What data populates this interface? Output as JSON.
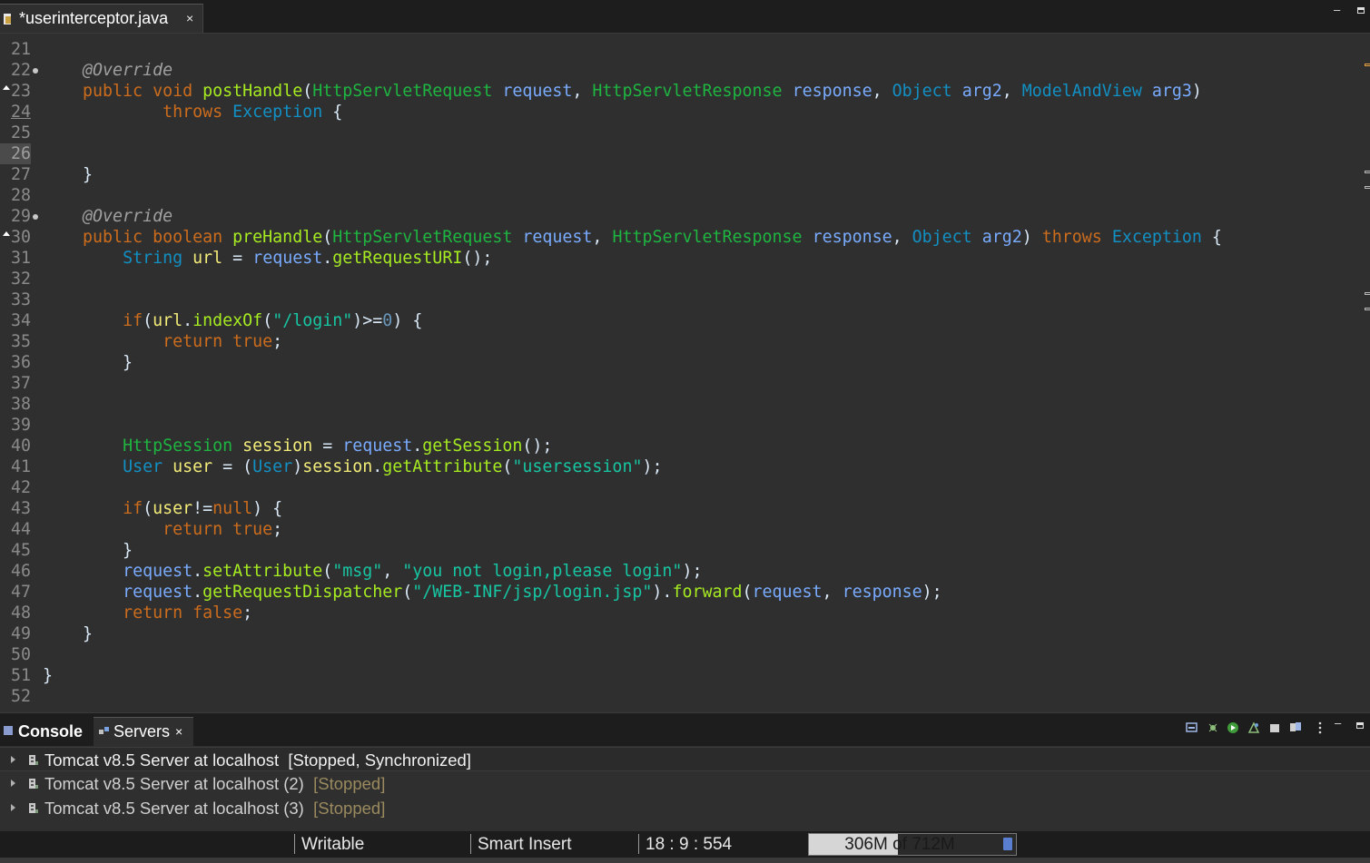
{
  "editor": {
    "tab": {
      "label": "*userinterceptor.java",
      "close": "×",
      "icon": "java-file-icon"
    },
    "window_buttons": {
      "minimize": "–",
      "maximize": "▪"
    }
  },
  "code_lines": [
    {
      "n": "21",
      "segs": []
    },
    {
      "n": "22",
      "marker": "dot",
      "segs": [
        [
          "    ",
          ""
        ],
        [
          "@Override",
          "ann"
        ]
      ]
    },
    {
      "n": "23",
      "marker": "tri",
      "segs": [
        [
          "    ",
          ""
        ],
        [
          "public",
          "kw"
        ],
        [
          " ",
          ""
        ],
        [
          "void",
          "kw"
        ],
        [
          " ",
          ""
        ],
        [
          "postHandle",
          "mth"
        ],
        [
          "(",
          ""
        ],
        [
          "HttpServletRequest",
          "ty2"
        ],
        [
          " ",
          ""
        ],
        [
          "request",
          "prm"
        ],
        [
          ", ",
          ""
        ],
        [
          "HttpServletResponse",
          "ty2"
        ],
        [
          " ",
          ""
        ],
        [
          "response",
          "prm"
        ],
        [
          ", ",
          ""
        ],
        [
          "Object",
          "ty"
        ],
        [
          " ",
          ""
        ],
        [
          "arg2",
          "prm"
        ],
        [
          ", ",
          ""
        ],
        [
          "ModelAndView",
          "ty"
        ],
        [
          " ",
          ""
        ],
        [
          "arg3",
          "prm"
        ],
        [
          ")",
          ""
        ]
      ]
    },
    {
      "n": "24",
      "ul": true,
      "segs": [
        [
          "            ",
          ""
        ],
        [
          "throws",
          "kw"
        ],
        [
          " ",
          ""
        ],
        [
          "Exception",
          "ty"
        ],
        [
          " {",
          ""
        ]
      ]
    },
    {
      "n": "25",
      "segs": []
    },
    {
      "n": "26",
      "cur": true,
      "segs": []
    },
    {
      "n": "27",
      "segs": [
        [
          "    }",
          ""
        ]
      ]
    },
    {
      "n": "28",
      "segs": []
    },
    {
      "n": "29",
      "marker": "dot",
      "segs": [
        [
          "    ",
          ""
        ],
        [
          "@Override",
          "ann"
        ]
      ]
    },
    {
      "n": "30",
      "marker": "tri",
      "segs": [
        [
          "    ",
          ""
        ],
        [
          "public",
          "kw"
        ],
        [
          " ",
          ""
        ],
        [
          "boolean",
          "kw"
        ],
        [
          " ",
          ""
        ],
        [
          "preHandle",
          "mth"
        ],
        [
          "(",
          ""
        ],
        [
          "HttpServletRequest",
          "ty2"
        ],
        [
          " ",
          ""
        ],
        [
          "request",
          "prm"
        ],
        [
          ", ",
          ""
        ],
        [
          "HttpServletResponse",
          "ty2"
        ],
        [
          " ",
          ""
        ],
        [
          "response",
          "prm"
        ],
        [
          ", ",
          ""
        ],
        [
          "Object",
          "ty"
        ],
        [
          " ",
          ""
        ],
        [
          "arg2",
          "prm"
        ],
        [
          ") ",
          ""
        ],
        [
          "throws",
          "kw"
        ],
        [
          " ",
          ""
        ],
        [
          "Exception",
          "ty"
        ],
        [
          " {",
          ""
        ]
      ]
    },
    {
      "n": "31",
      "segs": [
        [
          "        ",
          ""
        ],
        [
          "String",
          "ty"
        ],
        [
          " ",
          ""
        ],
        [
          "url",
          "lv"
        ],
        [
          " = ",
          ""
        ],
        [
          "request",
          "prm"
        ],
        [
          ".",
          ""
        ],
        [
          "getRequestURI",
          "mth"
        ],
        [
          "();",
          ""
        ]
      ]
    },
    {
      "n": "32",
      "segs": []
    },
    {
      "n": "33",
      "segs": []
    },
    {
      "n": "34",
      "segs": [
        [
          "        ",
          ""
        ],
        [
          "if",
          "kw"
        ],
        [
          "(",
          ""
        ],
        [
          "url",
          "lv"
        ],
        [
          ".",
          ""
        ],
        [
          "indexOf",
          "mth"
        ],
        [
          "(",
          ""
        ],
        [
          "\"/login\"",
          "str"
        ],
        [
          ")>=",
          ""
        ],
        [
          "0",
          "num"
        ],
        [
          ") {",
          ""
        ]
      ]
    },
    {
      "n": "35",
      "segs": [
        [
          "            ",
          ""
        ],
        [
          "return",
          "kw"
        ],
        [
          " ",
          ""
        ],
        [
          "true",
          "kw"
        ],
        [
          ";",
          ""
        ]
      ]
    },
    {
      "n": "36",
      "segs": [
        [
          "        }",
          ""
        ]
      ]
    },
    {
      "n": "37",
      "segs": []
    },
    {
      "n": "38",
      "segs": []
    },
    {
      "n": "39",
      "segs": []
    },
    {
      "n": "40",
      "segs": [
        [
          "        ",
          ""
        ],
        [
          "HttpSession",
          "ty2"
        ],
        [
          " ",
          ""
        ],
        [
          "session",
          "lv"
        ],
        [
          " = ",
          ""
        ],
        [
          "request",
          "prm"
        ],
        [
          ".",
          ""
        ],
        [
          "getSession",
          "mth"
        ],
        [
          "();",
          ""
        ]
      ]
    },
    {
      "n": "41",
      "segs": [
        [
          "        ",
          ""
        ],
        [
          "User",
          "ty"
        ],
        [
          " ",
          ""
        ],
        [
          "user",
          "lv"
        ],
        [
          " = (",
          ""
        ],
        [
          "User",
          "ty"
        ],
        [
          ")",
          ""
        ],
        [
          "session",
          "lv"
        ],
        [
          ".",
          ""
        ],
        [
          "getAttribute",
          "mth"
        ],
        [
          "(",
          ""
        ],
        [
          "\"usersession\"",
          "str"
        ],
        [
          ");",
          ""
        ]
      ]
    },
    {
      "n": "42",
      "segs": []
    },
    {
      "n": "43",
      "segs": [
        [
          "        ",
          ""
        ],
        [
          "if",
          "kw"
        ],
        [
          "(",
          ""
        ],
        [
          "user",
          "lv"
        ],
        [
          "!=",
          ""
        ],
        [
          "null",
          "kw"
        ],
        [
          ") {",
          ""
        ]
      ]
    },
    {
      "n": "44",
      "segs": [
        [
          "            ",
          ""
        ],
        [
          "return",
          "kw"
        ],
        [
          " ",
          ""
        ],
        [
          "true",
          "kw"
        ],
        [
          ";",
          ""
        ]
      ]
    },
    {
      "n": "45",
      "segs": [
        [
          "        }",
          ""
        ]
      ]
    },
    {
      "n": "46",
      "segs": [
        [
          "        ",
          ""
        ],
        [
          "request",
          "prm"
        ],
        [
          ".",
          ""
        ],
        [
          "setAttribute",
          "mth"
        ],
        [
          "(",
          ""
        ],
        [
          "\"msg\"",
          "str"
        ],
        [
          ", ",
          ""
        ],
        [
          "\"you not login,please login\"",
          "str"
        ],
        [
          ");",
          ""
        ]
      ]
    },
    {
      "n": "47",
      "segs": [
        [
          "        ",
          ""
        ],
        [
          "request",
          "prm"
        ],
        [
          ".",
          ""
        ],
        [
          "getRequestDispatcher",
          "mth"
        ],
        [
          "(",
          ""
        ],
        [
          "\"/WEB-INF/jsp/login.jsp\"",
          "str"
        ],
        [
          ").",
          ""
        ],
        [
          "forward",
          "mth"
        ],
        [
          "(",
          ""
        ],
        [
          "request",
          "prm"
        ],
        [
          ", ",
          ""
        ],
        [
          "response",
          "prm"
        ],
        [
          ");",
          ""
        ]
      ]
    },
    {
      "n": "48",
      "segs": [
        [
          "        ",
          ""
        ],
        [
          "return",
          "kw"
        ],
        [
          " ",
          ""
        ],
        [
          "false",
          "kw"
        ],
        [
          ";",
          ""
        ]
      ]
    },
    {
      "n": "49",
      "segs": [
        [
          "    }",
          ""
        ]
      ]
    },
    {
      "n": "50",
      "segs": []
    },
    {
      "n": "51",
      "segs": [
        [
          "}",
          ""
        ]
      ]
    },
    {
      "n": "52",
      "segs": []
    }
  ],
  "panel": {
    "console_tab": "Console",
    "servers_tab": "Servers",
    "close": "×",
    "toolbar_icons": [
      "collapse-icon",
      "debug-server-icon",
      "start-server-icon",
      "profile-server-icon",
      "stop-server-icon",
      "publish-icon",
      "view-menu-icon",
      "minimize-icon",
      "maximize-icon"
    ]
  },
  "servers": [
    {
      "name": "Tomcat v8.5 Server at localhost",
      "status": "[Stopped, Synchronized]",
      "selected": true
    },
    {
      "name": "Tomcat v8.5 Server at localhost (2)",
      "status": "[Stopped]",
      "selected": false
    },
    {
      "name": "Tomcat v8.5 Server at localhost (3)",
      "status": "[Stopped]",
      "selected": false
    }
  ],
  "status_bar": {
    "writable": "Writable",
    "insert_mode": "Smart Insert",
    "position": "18 : 9 : 554",
    "heap_used": "306M",
    "heap_rest": " of 712M",
    "heap_fraction": 0.43
  },
  "colors": {
    "keyword": "#cc6c1d",
    "type": "#1290c3",
    "string": "#17c6a3",
    "method": "#a7ec21",
    "background": "#2f2f2f"
  }
}
